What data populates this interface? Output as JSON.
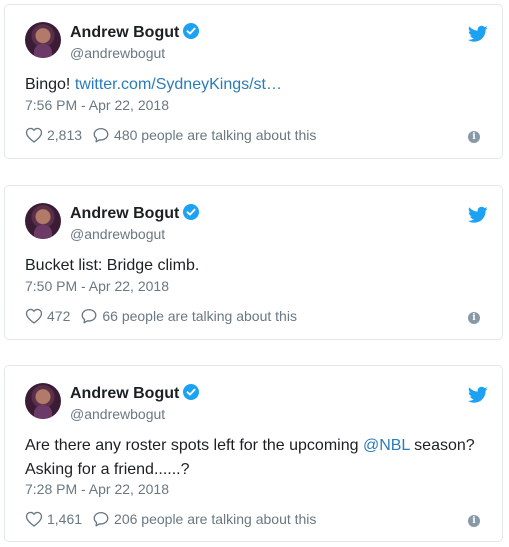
{
  "tweets": [
    {
      "author_name": "Andrew Bogut",
      "handle": "@andrewbogut",
      "text_plain": "Bingo! ",
      "text_link": "twitter.com/SydneyKings/st…",
      "timestamp": "7:56 PM - Apr 22, 2018",
      "likes": "2,813",
      "talking": "480 people are talking about this"
    },
    {
      "author_name": "Andrew Bogut",
      "handle": "@andrewbogut",
      "text_plain": "Bucket list: Bridge climb.",
      "timestamp": "7:50 PM - Apr 22, 2018",
      "likes": "472",
      "talking": "66 people are talking about this"
    },
    {
      "author_name": "Andrew Bogut",
      "handle": "@andrewbogut",
      "text_before": "Are there any roster spots left for the upcoming ",
      "text_mention": "@NBL",
      "text_after": " season? Asking for a friend......?",
      "timestamp": "7:28 PM - Apr 22, 2018",
      "likes": "1,461",
      "talking": "206 people are talking about this"
    }
  ],
  "icons": {
    "verified": "verified-badge-icon",
    "brand": "twitter-bird-icon",
    "like": "heart-icon",
    "reply": "speech-bubble-icon",
    "info": "info-icon"
  },
  "colors": {
    "brand_blue": "#1da1f2",
    "link_blue": "#2b7bb9",
    "text": "#1c2022",
    "muted": "#697882",
    "border": "#e1e8ed"
  }
}
